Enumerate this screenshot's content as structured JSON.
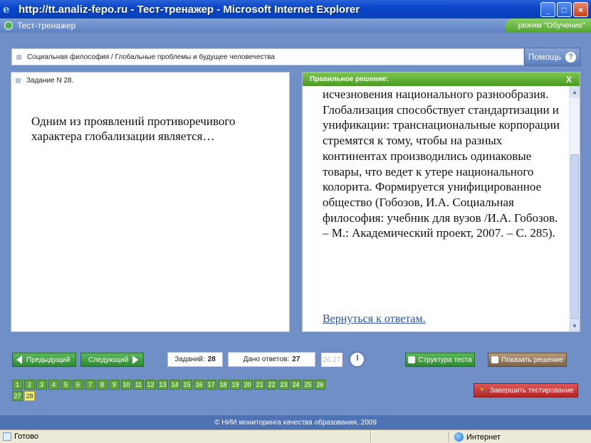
{
  "window": {
    "title": "http://tt.analiz-fepo.ru - Тест-тренажер - Microsoft Internet Explorer",
    "min_label": "_",
    "max_label": "□",
    "close_label": "×"
  },
  "app": {
    "name": "Тест-тренажер",
    "mode": "режим \"Обучение\""
  },
  "breadcrumb": "Социальная философия / Глобальные проблемы и будущее человечества",
  "help_label": "Помощь",
  "help_icon_glyph": "?",
  "task": {
    "header": "Задание N 28.",
    "question": "Одним из проявлений противоречивого характера глобализации является…"
  },
  "solution": {
    "header": "Правильное решение:",
    "close_glyph": "X",
    "text": "исчезновения национального разнообразия. Глобализация способствует стандартизации и унификации: транснациональные корпорации стремятся к тому, чтобы на разных континентах производились одинаковые товары, что ведет к утере национального колорита. Формируется унифицированное общество (Гобозов, И.А. Социальная философия: учебник для вузов /И.А. Гобозов. – М.: Академический проект, 2007. – С. 285).",
    "back_link": "Вернуться к ответам."
  },
  "nav": {
    "prev_label": "Предыдущий",
    "next_label": "Следующий",
    "tasks_label": "Заданий:",
    "tasks_count": "28",
    "answers_label": "Дано ответов:",
    "answers_count": "27",
    "timer": "26:27"
  },
  "actions": {
    "structure_label": "Структура теста",
    "show_solution_label": "Показать решение",
    "finish_label": "Завершить тестирование"
  },
  "pages": [
    "1",
    "2",
    "3",
    "4",
    "5",
    "6",
    "7",
    "8",
    "9",
    "10",
    "11",
    "12",
    "13",
    "14",
    "15",
    "16",
    "17",
    "18",
    "19",
    "20",
    "21",
    "22",
    "23",
    "24",
    "25",
    "26",
    "27",
    "28"
  ],
  "current_page": "28",
  "footer": "© НИИ мониторинга качества образования, 2009",
  "status": {
    "left": "Готово",
    "zone": "Интернет"
  },
  "colors": {
    "green_button": "#2f8a2f",
    "solution_header": "#4a9a22",
    "finish_button": "#b32424",
    "current_page": "#f3f07a"
  }
}
